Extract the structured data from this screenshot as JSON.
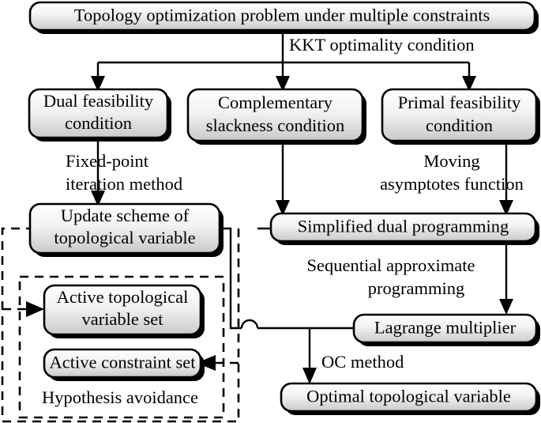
{
  "diagram": {
    "title": "Topology optimization KKT flowchart",
    "background": "#ffffff",
    "box_fill_top": "#ffffff",
    "box_fill_bottom": "#cfcfcf",
    "stroke": "#000000"
  },
  "nodes": {
    "problem": {
      "label": "Topology optimization problem under multiple constraints"
    },
    "dual_feasibility_line1": {
      "label": "Dual feasibility"
    },
    "dual_feasibility_line2": {
      "label": "condition"
    },
    "complementary_line1": {
      "label": "Complementary"
    },
    "complementary_line2": {
      "label": "slackness condition"
    },
    "primal_line1": {
      "label": "Primal feasibility"
    },
    "primal_line2": {
      "label": "condition"
    },
    "update_scheme_line1": {
      "label": "Update scheme of"
    },
    "update_scheme_line2": {
      "label": "topological variable"
    },
    "simplified_dual": {
      "label": "Simplified dual programming"
    },
    "active_topo_line1": {
      "label": "Active topological"
    },
    "active_topo_line2": {
      "label": "variable set"
    },
    "active_constraint": {
      "label": "Active constraint set"
    },
    "lagrange": {
      "label": "Lagrange multiplier"
    },
    "optimal": {
      "label": "Optimal topological variable"
    }
  },
  "edge_labels": {
    "kkt": "KKT optimality condition",
    "fixed_point_line1": "Fixed-point",
    "fixed_point_line2": "iteration method",
    "moving_line1": "Moving",
    "moving_line2": "asymptotes function",
    "sequential_line1": "Sequential approximate",
    "sequential_line2": "programming",
    "oc_method": "OC method"
  },
  "group_labels": {
    "hypothesis_avoidance": "Hypothesis avoidance"
  }
}
